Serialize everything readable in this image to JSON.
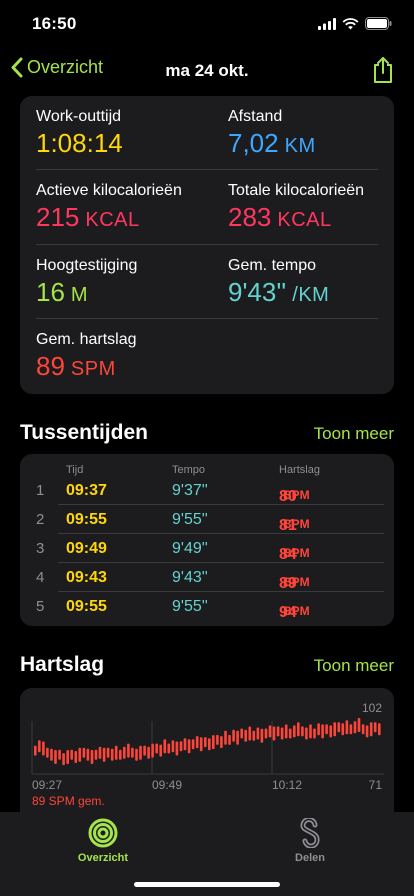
{
  "status_bar": {
    "time": "16:50"
  },
  "nav": {
    "back_label": "Overzicht",
    "title": "ma 24 okt."
  },
  "metrics": [
    {
      "label": "Work-outtijd",
      "value": "1:08:14",
      "unit": "",
      "color": "#ffd60a"
    },
    {
      "label": "Afstand",
      "value": "7,02",
      "unit": "KM",
      "color": "#3ea7ff"
    },
    {
      "label": "Actieve kilocalorieën",
      "value": "215",
      "unit": "KCAL",
      "color": "#ff375f"
    },
    {
      "label": "Totale kilocalorieën",
      "value": "283",
      "unit": "KCAL",
      "color": "#ff375f"
    },
    {
      "label": "Hoogtestijging",
      "value": "16",
      "unit": "M",
      "color": "#a5e34a"
    },
    {
      "label": "Gem. tempo",
      "value": "9'43''",
      "unit": "/KM",
      "color": "#64d2cf"
    },
    {
      "label": "Gem. hartslag",
      "value": "89",
      "unit": "SPM",
      "color": "#ff453a"
    }
  ],
  "splits": {
    "title": "Tussentijden",
    "link": "Toon meer",
    "headers": {
      "time": "Tijd",
      "pace": "Tempo",
      "hr": "Hartslag"
    },
    "rows": [
      {
        "idx": "1",
        "time": "09:37",
        "pace": "9'37''",
        "hr": "80",
        "unit": "BPM"
      },
      {
        "idx": "2",
        "time": "09:55",
        "pace": "9'55''",
        "hr": "81",
        "unit": "BPM"
      },
      {
        "idx": "3",
        "time": "09:49",
        "pace": "9'49''",
        "hr": "84",
        "unit": "BPM"
      },
      {
        "idx": "4",
        "time": "09:43",
        "pace": "9'43''",
        "hr": "89",
        "unit": "BPM"
      },
      {
        "idx": "5",
        "time": "09:55",
        "pace": "9'55''",
        "hr": "94",
        "unit": "BPM"
      }
    ]
  },
  "heart_rate": {
    "title": "Hartslag",
    "link": "Toon meer",
    "footer": "89 SPM gem.",
    "chart_data": {
      "type": "bar",
      "x_ticks": [
        "09:27",
        "09:49",
        "10:12"
      ],
      "y_max_label": "102",
      "y_min_label": "71",
      "ylim": [
        71,
        102
      ],
      "color": "#ff453a",
      "values": [
        82,
        84,
        83,
        81,
        80,
        79,
        80,
        78,
        79,
        80,
        79,
        80,
        81,
        80,
        79,
        80,
        81,
        80,
        81,
        80,
        81,
        80,
        81,
        82,
        81,
        80,
        81,
        82,
        81,
        82,
        83,
        82,
        84,
        83,
        84,
        83,
        84,
        85,
        84,
        85,
        86,
        85,
        86,
        85,
        86,
        87,
        86,
        88,
        87,
        89,
        88,
        90,
        89,
        90,
        89,
        90,
        89,
        90,
        91,
        90,
        91,
        90,
        91,
        90,
        91,
        92,
        91,
        90,
        91,
        90,
        92,
        91,
        92,
        91,
        92,
        93,
        92,
        93,
        92,
        93,
        94,
        92,
        91,
        92,
        93,
        92
      ]
    }
  },
  "tab_bar": {
    "items": [
      {
        "label": "Overzicht",
        "color": "#a5e34a"
      },
      {
        "label": "Delen",
        "color": "#8e8e93"
      }
    ]
  }
}
